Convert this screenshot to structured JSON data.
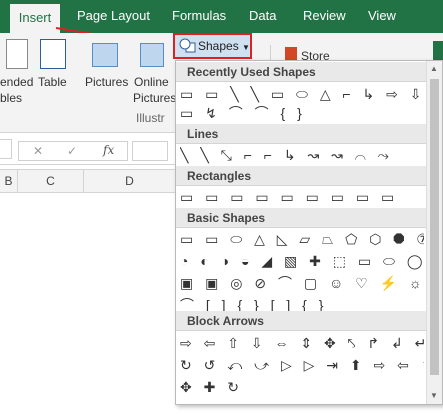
{
  "tabs": {
    "insert": "Insert",
    "page_layout": "Page Layout",
    "formulas": "Formulas",
    "data": "Data",
    "review": "Review",
    "view": "View"
  },
  "ribbon": {
    "recommended": "ended",
    "pivottables": "bles",
    "table": "Table",
    "pictures": "Pictures",
    "online": "Online",
    "pictures2": "Pictures",
    "group_illus": "Illustr",
    "shapes": "Shapes",
    "store": "Store"
  },
  "formula": {
    "fx": "fx",
    "x": "✕",
    "check": "✓"
  },
  "columns": [
    "B",
    "C",
    "D"
  ],
  "gallery": {
    "sections": [
      "Recently Used Shapes",
      "Lines",
      "Rectangles",
      "Basic Shapes",
      "Block Arrows"
    ],
    "recent": [
      "▭ ▭ ╲ ╲ ▭ ⬭ △ ⌐ ↳ ⇨ ⇩",
      "▭ ↯ ⌒ ⌒ { }"
    ],
    "lines": "╲ ╲ ⤡ ⌐ ⌐ ↳ ↝ ↝ ⌒ ⤳",
    "rectangles": "▭ ▭ ▭ ▭ ▭ ▭ ▭ ▭ ▭",
    "basic": [
      "▭ ▭ ⬭ △ ◺ ▱ ⏢ ⬠ ⬡ ⯃ ⑦ ⑧",
      "◔ ◐ ◑ ◒ ◢ ▧ ✚ ⬚ ▭ ⬭ ◯ ⬚",
      "▣ ▣ ◎ ⊘ ⌒ ▢ ☺ ♡ ⚡ ☼ ☾ ⬮",
      "⌒ [ ] { } [ ] { }"
    ],
    "arrows": [
      "⇨ ⇦ ⇧ ⇩ ⇔ ⇕ ✥ ⤣ ↱ ↲ ↵ ⤴",
      "↻ ↺ ⤺ ⤻ ▷ ▷ ⇥ ⬆ ⇨ ⇦ ⇧ ⇩",
      "✥ ✚ ↻"
    ]
  }
}
